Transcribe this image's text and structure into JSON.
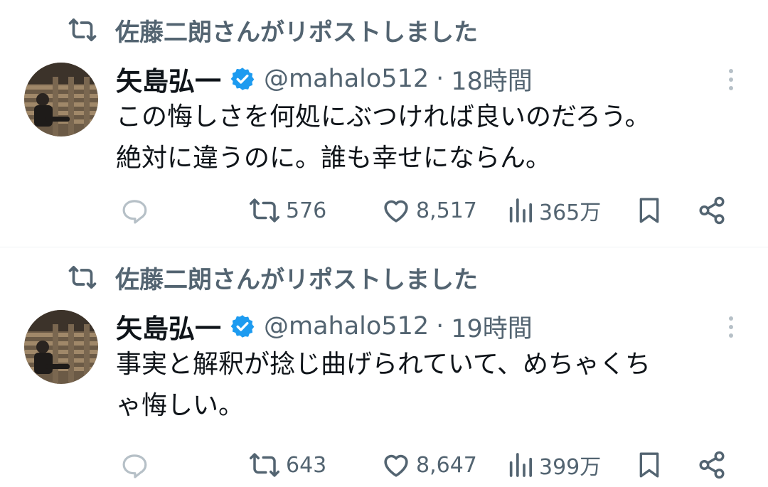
{
  "tweets": [
    {
      "repost_text": "佐藤二朗さんがリポストしました",
      "display_name": "矢島弘一",
      "handle": "@mahalo512",
      "separator": "·",
      "time": "18時間",
      "body": "この悔しさを何処にぶつければ良いのだろう。\n絶対に違うのに。誰も幸せにならん。",
      "retweets": "576",
      "likes": "8,517",
      "views": "365万"
    },
    {
      "repost_text": "佐藤二朗さんがリポストしました",
      "display_name": "矢島弘一",
      "handle": "@mahalo512",
      "separator": "·",
      "time": "19時間",
      "body": "事実と解釈が捻じ曲げられていて、めちゃくち\nゃ悔しい。",
      "retweets": "643",
      "likes": "8,647",
      "views": "399万"
    }
  ],
  "colors": {
    "text": "#0f1419",
    "secondary": "#536471",
    "verified": "#1d9bf0",
    "divider": "#eff3f4"
  },
  "icons": [
    "repost-icon",
    "verified-badge-icon",
    "more-options-icon",
    "reply-icon",
    "retweet-icon",
    "like-icon",
    "views-icon",
    "bookmark-icon",
    "share-icon"
  ]
}
